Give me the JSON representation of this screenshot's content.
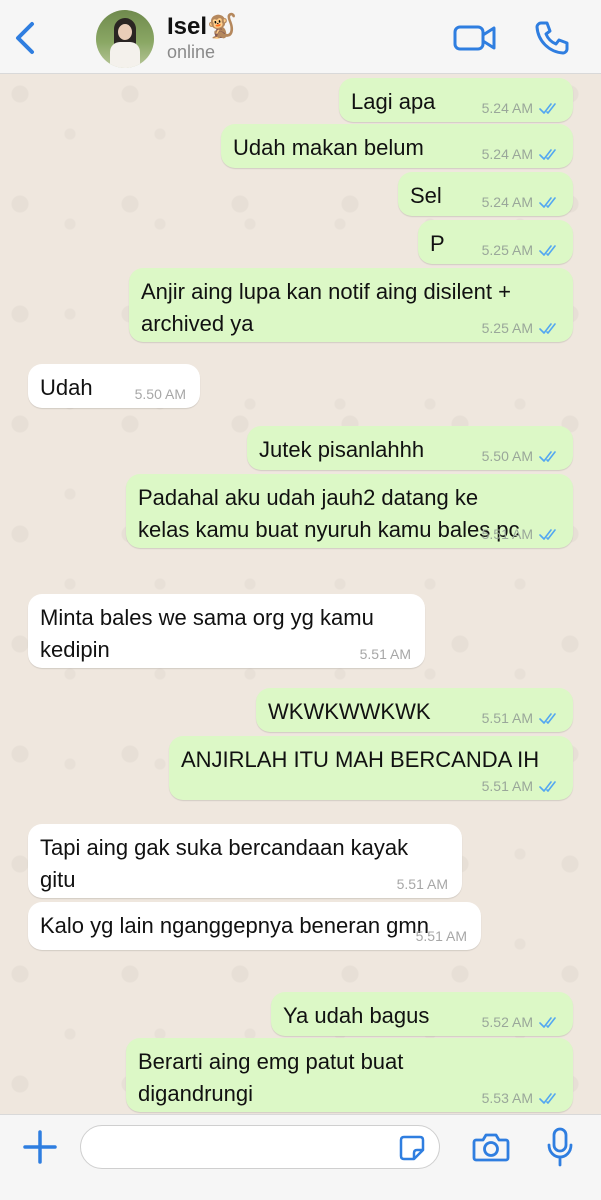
{
  "header": {
    "contact_name": "Isel🐒",
    "status": "online"
  },
  "colors": {
    "accent": "#2f7ee0",
    "outgoing_bubble": "#dcf8c6",
    "incoming_bubble": "#ffffff",
    "read_tick": "#53a7f1"
  },
  "icons": {
    "back": "chevron-left-icon",
    "video": "video-call-icon",
    "call": "phone-icon",
    "plus": "plus-icon",
    "sticker": "sticker-icon",
    "camera": "camera-icon",
    "mic": "microphone-icon"
  },
  "messages": [
    {
      "dir": "out",
      "text": "Lagi apa",
      "time": "5.24 AM",
      "read": true
    },
    {
      "dir": "out",
      "text": "Udah makan belum",
      "time": "5.24 AM",
      "read": true
    },
    {
      "dir": "out",
      "text": "Sel",
      "time": "5.24 AM",
      "read": true
    },
    {
      "dir": "out",
      "text": "P",
      "time": "5.25 AM",
      "read": true
    },
    {
      "dir": "out",
      "text": "Anjir aing lupa kan notif aing disilent +\narchived ya",
      "time": "5.25 AM",
      "read": true
    },
    {
      "dir": "in",
      "text": "Udah",
      "time": "5.50 AM"
    },
    {
      "dir": "out",
      "text": "Jutek pisanlahhh",
      "time": "5.50 AM",
      "read": true
    },
    {
      "dir": "out",
      "text": "Padahal aku udah jauh2 datang ke\nkelas kamu buat nyuruh kamu bales pc",
      "time": "5.51 AM",
      "read": true
    },
    {
      "dir": "in",
      "text": "Minta bales we sama org yg kamu\nkedipin",
      "time": "5.51 AM"
    },
    {
      "dir": "out",
      "text": "WKWKWWKWK",
      "time": "5.51 AM",
      "read": true
    },
    {
      "dir": "out",
      "text": "ANJIRLAH ITU MAH BERCANDA IH",
      "time": "5.51 AM",
      "read": true
    },
    {
      "dir": "in",
      "text": "Tapi aing gak suka bercandaan kayak\ngitu",
      "time": "5.51 AM"
    },
    {
      "dir": "in",
      "text": "Kalo yg lain nganggepnya beneran gmn",
      "time": "5.51 AM"
    },
    {
      "dir": "out",
      "text": "Ya udah bagus",
      "time": "5.52 AM",
      "read": true
    },
    {
      "dir": "out",
      "text": "Berarti aing emg patut buat\ndigandrungi",
      "time": "5.53 AM",
      "read": true
    }
  ],
  "input": {
    "placeholder": "",
    "value": ""
  }
}
